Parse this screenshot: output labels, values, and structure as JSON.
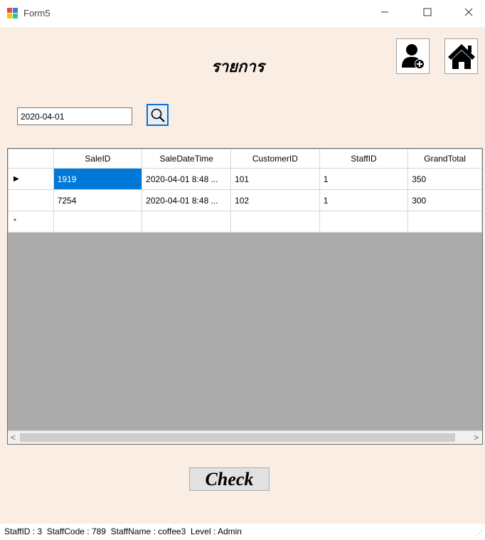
{
  "window": {
    "title": "Form5",
    "controls": {
      "minimize": "minimize-icon",
      "maximize": "maximize-icon",
      "close": "close-icon"
    }
  },
  "header": {
    "title": "รายการ",
    "buttons": [
      {
        "name": "add-user",
        "icon": "add-user-icon"
      },
      {
        "name": "home",
        "icon": "home-icon"
      }
    ]
  },
  "search": {
    "date_value": "2020-04-01",
    "button_icon": "magnifier-icon"
  },
  "grid": {
    "columns": [
      "SaleID",
      "SaleDateTime",
      "CustomerID",
      "StaffID",
      "GrandTotal"
    ],
    "rows": [
      {
        "marker": "▶",
        "cells": [
          "1919",
          "2020-04-01 8:48 ...",
          "101",
          "1",
          "350"
        ]
      },
      {
        "marker": "",
        "cells": [
          "7254",
          "2020-04-01 8:48 ...",
          "102",
          "1",
          "300"
        ]
      },
      {
        "marker": "*",
        "cells": [
          "",
          "",
          "",
          "",
          ""
        ]
      }
    ],
    "scroll_left": "<",
    "scroll_right": ">"
  },
  "actions": {
    "check_label": "Check"
  },
  "status": {
    "text": "StaffID : 3  StaffCode : 789  StaffName : coffee3  Level : Admin",
    "grip": "⋰"
  },
  "colors": {
    "form_bg": "#faeee4",
    "selection": "#0078d7",
    "grid_empty": "#ababab"
  }
}
